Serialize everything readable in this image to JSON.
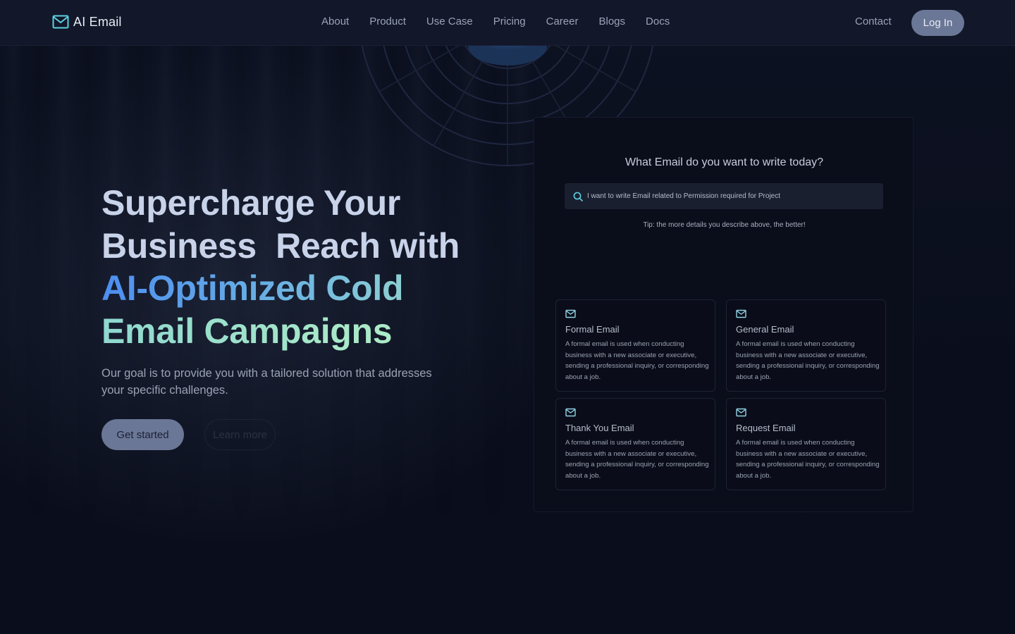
{
  "brand": {
    "name": "AI Email",
    "icon": "mail-icon",
    "accent": "#5ad0e0"
  },
  "nav": {
    "links": [
      "About",
      "Product",
      "Use Case",
      "Pricing",
      "Career",
      "Blogs",
      "Docs"
    ],
    "contact": "Contact",
    "login": "Log In"
  },
  "hero": {
    "title_line1": "Supercharge Your",
    "title_line2": "Business  Reach with",
    "title_line3": "AI-Optimized Cold",
    "title_line4": "Email Campaigns",
    "subtitle": "Our goal is to provide you with a tailored solution that addresses your specific challenges.",
    "cta_primary": "Get started",
    "cta_secondary": "Learn more"
  },
  "panel": {
    "title": "What Email do you want to write today?",
    "search_value": "I want to write Email related to Permission required for Project",
    "search_icon": "search-icon",
    "tip": "Tip: the more details you describe above, the better!",
    "cards": [
      {
        "title": "Formal Email",
        "icon": "mail-icon",
        "description": "A formal email is used when conducting business with a new associate or executive, sending a professional inquiry, or corresponding about a job."
      },
      {
        "title": "General Email",
        "icon": "mail-icon",
        "description": "A formal email is used when conducting business with a new associate or executive, sending a professional inquiry, or corresponding about a job."
      },
      {
        "title": "Thank You Email",
        "icon": "mail-icon",
        "description": "A formal email is used when conducting business with a new associate or executive, sending a professional inquiry, or corresponding about a job."
      },
      {
        "title": "Request Email",
        "icon": "mail-icon",
        "description": "A formal email is used when conducting business with a new associate or executive, sending a professional inquiry, or corresponding about a job."
      }
    ]
  }
}
